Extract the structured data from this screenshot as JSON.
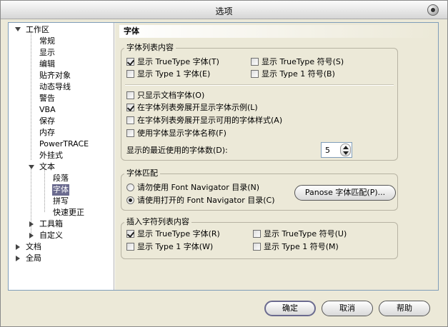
{
  "window": {
    "title": "选项"
  },
  "tree": {
    "root": "工作区",
    "workspace_children": [
      "常规",
      "显示",
      "编辑",
      "贴齐对象",
      "动态导线",
      "警告",
      "VBA",
      "保存",
      "内存",
      "PowerTRACE",
      "外挂式"
    ],
    "text_node": "文本",
    "text_children": [
      "段落",
      "字体",
      "拼写",
      "快速更正"
    ],
    "toolbox": "工具箱",
    "customize": "自定义",
    "document": "文档",
    "global": "全局"
  },
  "panel": {
    "header": "字体",
    "list_group": {
      "title": "字体列表内容",
      "show_truetype_font": "显示 TrueType 字体(T)",
      "show_truetype_symbol": "显示 TrueType 符号(S)",
      "show_type1_font": "显示 Type 1 字体(E)",
      "show_type1_symbol": "显示 Type 1 符号(B)",
      "only_doc_fonts": "只显示文档字体(O)",
      "show_sample": "在字体列表旁展开显示字体示例(L)",
      "show_styles": "在字体列表旁展开显示可用的字体样式(A)",
      "use_font_name": "使用字体显示字体名称(F)",
      "recent_label": "显示的最近使用的字体数(D):",
      "recent_value": "5"
    },
    "match_group": {
      "title": "字体匹配",
      "no_navigator": "请勿使用 Font Navigator 目录(N)",
      "use_navigator": "请使用打开的 Font Navigator 目录(C)",
      "panose_button": "Panose 字体匹配(P)..."
    },
    "insert_group": {
      "title": "插入字符列表内容",
      "show_truetype_font": "显示 TrueType 字体(R)",
      "show_truetype_symbol": "显示 TrueType 符号(U)",
      "show_type1_font": "显示 Type 1 字体(W)",
      "show_type1_symbol": "显示 Type 1 符号(M)"
    }
  },
  "buttons": {
    "ok": "确定",
    "cancel": "取消",
    "help": "帮助"
  }
}
